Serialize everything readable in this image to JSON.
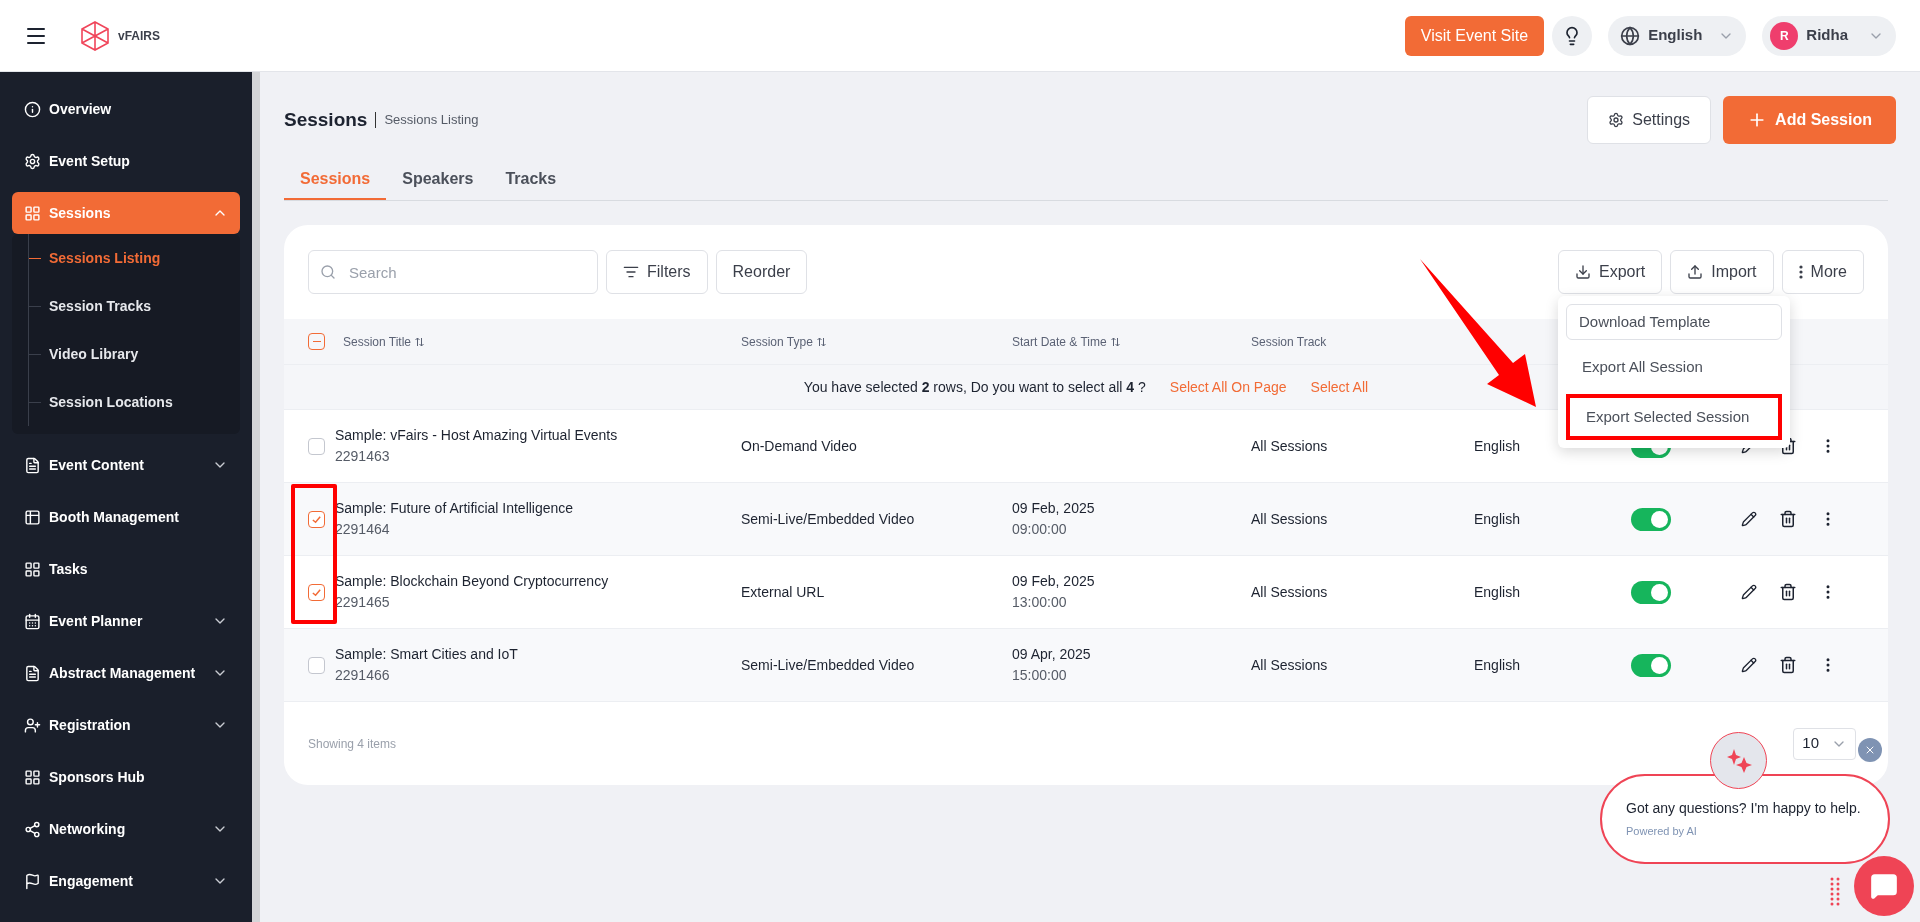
{
  "header": {
    "logo": "vFAIRS",
    "visit_button": "Visit Event Site",
    "language": "English",
    "user": {
      "initial": "R",
      "name": "Ridha"
    }
  },
  "sidebar": {
    "items": [
      {
        "label": "Overview",
        "selected": false
      },
      {
        "label": "Event Setup",
        "selected": false
      },
      {
        "label": "Sessions",
        "selected": true,
        "expanded": true,
        "children": [
          {
            "label": "Sessions Listing",
            "selected": true
          },
          {
            "label": "Session Tracks",
            "selected": false
          },
          {
            "label": "Video Library",
            "selected": false
          },
          {
            "label": "Session Locations",
            "selected": false
          }
        ]
      },
      {
        "label": "Event Content",
        "selected": false,
        "expanded": false
      },
      {
        "label": "Booth Management",
        "selected": false
      },
      {
        "label": "Tasks",
        "selected": false
      },
      {
        "label": "Event Planner",
        "selected": false,
        "expanded": false
      },
      {
        "label": "Abstract Management",
        "selected": false,
        "expanded": false
      },
      {
        "label": "Registration",
        "selected": false,
        "expanded": false
      },
      {
        "label": "Sponsors Hub",
        "selected": false
      },
      {
        "label": "Networking",
        "selected": false,
        "expanded": false
      },
      {
        "label": "Engagement",
        "selected": false,
        "expanded": false
      }
    ]
  },
  "page": {
    "title": "Sessions",
    "breadcrumb": "Sessions Listing",
    "settings_button": "Settings",
    "add_button": "Add Session"
  },
  "tabs": [
    {
      "label": "Sessions",
      "selected": true
    },
    {
      "label": "Speakers",
      "selected": false
    },
    {
      "label": "Tracks",
      "selected": false
    }
  ],
  "toolbar": {
    "search_placeholder": "Search",
    "filters": "Filters",
    "reorder": "Reorder",
    "export": "Export",
    "import": "Import",
    "more": "More"
  },
  "export_menu": [
    {
      "label": "Download Template",
      "kind": "outlined",
      "highlighted": false
    },
    {
      "label": "Export All Session",
      "kind": "plain",
      "highlighted": false
    },
    {
      "label": "Export Selected Session",
      "kind": "plain",
      "highlighted": true
    }
  ],
  "table": {
    "columns": [
      "Session Title",
      "Session Type",
      "Start Date & Time",
      "Session Track"
    ],
    "header_checkbox_partial": true,
    "selection_banner": {
      "text": "You have selected **2** rows, Do you want to select all **4** ?",
      "select_page": "Select All On Page",
      "select_all": "Select All"
    },
    "rows": [
      {
        "title": "Sample: vFairs - Host Amazing Virtual Events",
        "id": "2291463",
        "type": "On-Demand Video",
        "date": "",
        "time": "",
        "track": "All Sessions",
        "language": "English",
        "on": true,
        "selected": false
      },
      {
        "title": "Sample: Future of Artificial Intelligence",
        "id": "2291464",
        "type": "Semi-Live/Embedded Video",
        "date": "09 Feb, 2025",
        "time": "09:00:00",
        "track": "All Sessions",
        "language": "English",
        "on": true,
        "selected": true
      },
      {
        "title": "Sample: Blockchain Beyond Cryptocurrency",
        "id": "2291465",
        "type": "External URL",
        "date": "09 Feb, 2025",
        "time": "13:00:00",
        "track": "All Sessions",
        "language": "English",
        "on": true,
        "selected": true
      },
      {
        "title": "Sample: Smart Cities and IoT",
        "id": "2291466",
        "type": "Semi-Live/Embedded Video",
        "date": "09 Apr, 2025",
        "time": "15:00:00",
        "track": "All Sessions",
        "language": "English",
        "on": true,
        "selected": false
      }
    ],
    "footer": "Showing 4 items",
    "page_size": "10"
  },
  "chat": {
    "message": "Got any questions? I'm happy to help.",
    "powered": "Powered by AI"
  }
}
